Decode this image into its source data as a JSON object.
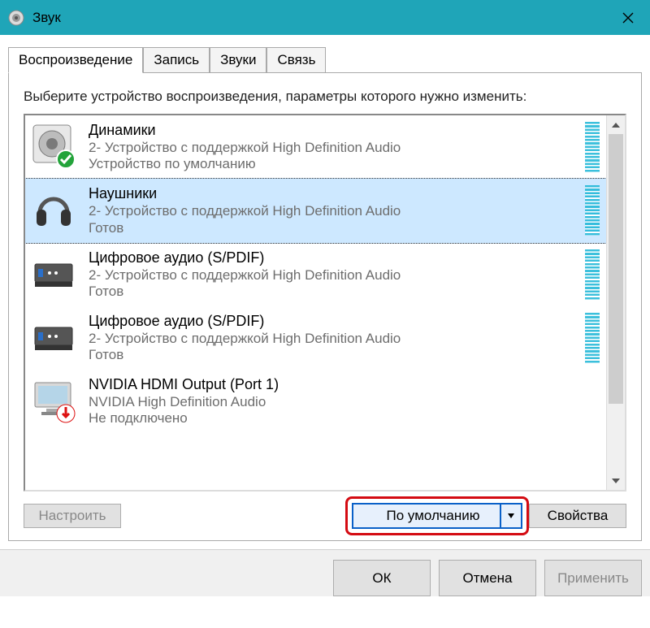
{
  "window": {
    "title": "Звук"
  },
  "tabs": {
    "playback": "Воспроизведение",
    "record": "Запись",
    "sounds": "Звуки",
    "comm": "Связь"
  },
  "instruction": "Выберите устройство воспроизведения, параметры которого нужно изменить:",
  "devices": [
    {
      "title": "Динамики",
      "sub": "2- Устройство с поддержкой High Definition Audio",
      "status": "Устройство по умолчанию"
    },
    {
      "title": "Наушники",
      "sub": "2- Устройство с поддержкой High Definition Audio",
      "status": "Готов"
    },
    {
      "title": "Цифровое аудио (S/PDIF)",
      "sub": "2- Устройство с поддержкой High Definition Audio",
      "status": "Готов"
    },
    {
      "title": "Цифровое аудио (S/PDIF)",
      "sub": "2- Устройство с поддержкой High Definition Audio",
      "status": "Готов"
    },
    {
      "title": "NVIDIA HDMI Output (Port 1)",
      "sub": "NVIDIA High Definition Audio",
      "status": "Не подключено"
    }
  ],
  "buttons": {
    "configure": "Настроить",
    "set_default": "По умолчанию",
    "properties": "Свойства",
    "ok": "ОК",
    "cancel": "Отмена",
    "apply": "Применить"
  }
}
